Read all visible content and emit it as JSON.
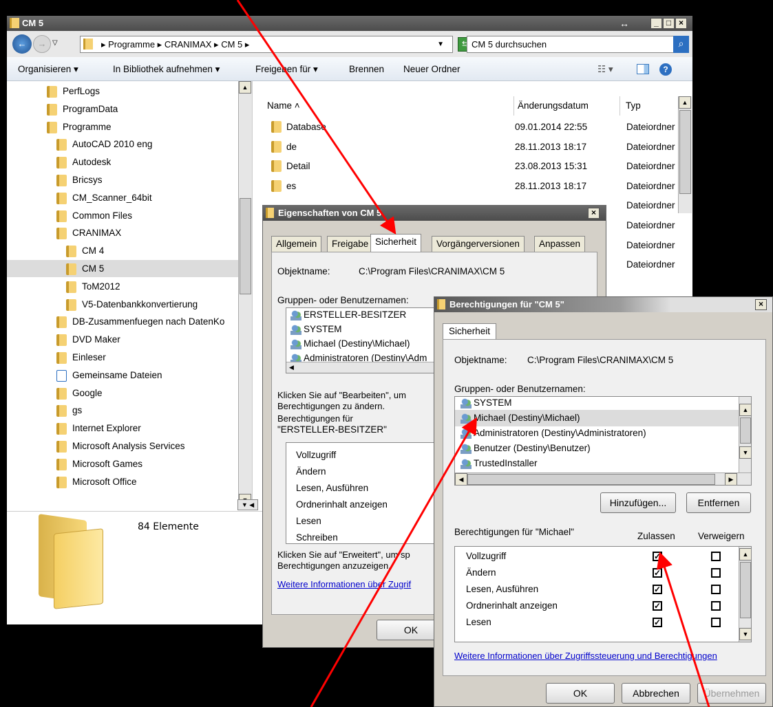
{
  "explorer": {
    "title": "CM 5",
    "address": [
      "Programme",
      "CRANIMAX",
      "CM 5"
    ],
    "search_placeholder": "CM 5 durchsuchen",
    "toolbar": {
      "organize": "Organisieren",
      "library": "In Bibliothek aufnehmen",
      "share": "Freigeben für",
      "burn": "Brennen",
      "new_folder": "Neuer Ordner"
    },
    "tree": [
      {
        "label": "PerfLogs",
        "indent": 0
      },
      {
        "label": "ProgramData",
        "indent": 0
      },
      {
        "label": "Programme",
        "indent": 0
      },
      {
        "label": "AutoCAD 2010 eng",
        "indent": 1
      },
      {
        "label": "Autodesk",
        "indent": 1
      },
      {
        "label": "Bricsys",
        "indent": 1
      },
      {
        "label": "CM_Scanner_64bit",
        "indent": 1
      },
      {
        "label": "Common Files",
        "indent": 1
      },
      {
        "label": "CRANIMAX",
        "indent": 1
      },
      {
        "label": "CM 4",
        "indent": 2
      },
      {
        "label": "CM 5",
        "indent": 2,
        "selected": true
      },
      {
        "label": "ToM2012",
        "indent": 2
      },
      {
        "label": "V5-Datenbankkonvertierung",
        "indent": 2
      },
      {
        "label": "DB-Zusammenfuegen nach DatenKo",
        "indent": 1
      },
      {
        "label": "DVD Maker",
        "indent": 1
      },
      {
        "label": "Einleser",
        "indent": 1
      },
      {
        "label": "Gemeinsame Dateien",
        "indent": 1,
        "shortcut": true
      },
      {
        "label": "Google",
        "indent": 1
      },
      {
        "label": "gs",
        "indent": 1
      },
      {
        "label": "Internet Explorer",
        "indent": 1
      },
      {
        "label": "Microsoft Analysis Services",
        "indent": 1
      },
      {
        "label": "Microsoft Games",
        "indent": 1
      },
      {
        "label": "Microsoft Office",
        "indent": 1
      }
    ],
    "columns": {
      "name": "Name",
      "date": "Änderungsdatum",
      "type": "Typ"
    },
    "files": [
      {
        "name": "Database",
        "date": "09.01.2014 22:55",
        "type": "Dateiordner"
      },
      {
        "name": "de",
        "date": "28.11.2013 18:17",
        "type": "Dateiordner"
      },
      {
        "name": "Detail",
        "date": "23.08.2013 15:31",
        "type": "Dateiordner"
      },
      {
        "name": "es",
        "date": "28.11.2013 18:17",
        "type": "Dateiordner"
      },
      {
        "name": "",
        "date": "",
        "type": "Dateiordner"
      },
      {
        "name": "",
        "date": "",
        "type": "Dateiordner"
      },
      {
        "name": "",
        "date": "",
        "type": "Dateiordner"
      },
      {
        "name": "",
        "date": "",
        "type": "Dateiordner"
      }
    ],
    "status": "84 Elemente"
  },
  "props": {
    "title": "Eigenschaften von CM 5",
    "tabs": [
      "Allgemein",
      "Freigabe",
      "Sicherheit",
      "Vorgängerversionen",
      "Anpassen"
    ],
    "object_label": "Objektname:",
    "object_value": "C:\\Program Files\\CRANIMAX\\CM 5",
    "groups_label": "Gruppen- oder Benutzernamen:",
    "users": [
      "ERSTELLER-BESITZER",
      "SYSTEM",
      "Michael (Destiny\\Michael)",
      "Administratoren (Destiny\\Adm"
    ],
    "edit_hint": "Klicken Sie auf \"Bearbeiten\", um",
    "edit_hint2": "Berechtigungen zu ändern.",
    "perm_for": "Berechtigungen für",
    "perm_for_user": "\"ERSTELLER-BESITZER\"",
    "perms": [
      "Vollzugriff",
      "Ändern",
      "Lesen, Ausführen",
      "Ordnerinhalt anzeigen",
      "Lesen",
      "Schreiben"
    ],
    "adv_hint": "Klicken Sie auf \"Erweitert\", um sp",
    "adv_hint2": "Berechtigungen anzuzeigen.",
    "link": "Weitere Informationen über Zugrif",
    "ok": "OK"
  },
  "perm": {
    "title": "Berechtigungen für \"CM 5\"",
    "tab": "Sicherheit",
    "object_label": "Objektname:",
    "object_value": "C:\\Program Files\\CRANIMAX\\CM 5",
    "groups_label": "Gruppen- oder Benutzernamen:",
    "users": [
      "SYSTEM",
      "Michael (Destiny\\Michael)",
      "Administratoren (Destiny\\Administratoren)",
      "Benutzer (Destiny\\Benutzer)",
      "TrustedInstaller"
    ],
    "add": "Hinzufügen...",
    "remove": "Entfernen",
    "perm_for": "Berechtigungen für \"Michael\"",
    "allow": "Zulassen",
    "deny": "Verweigern",
    "perms": [
      {
        "label": "Vollzugriff",
        "allow": true,
        "deny": false
      },
      {
        "label": "Ändern",
        "allow": true,
        "deny": false
      },
      {
        "label": "Lesen, Ausführen",
        "allow": true,
        "deny": false
      },
      {
        "label": "Ordnerinhalt anzeigen",
        "allow": true,
        "deny": false
      },
      {
        "label": "Lesen",
        "allow": true,
        "deny": false
      }
    ],
    "link": "Weitere Informationen über Zugriffssteuerung und Berechtigungen",
    "ok": "OK",
    "cancel": "Abbrechen",
    "apply": "Übernehmen"
  },
  "colors": {
    "annotation": "#ff0000",
    "selection": "#dcdcdc",
    "link": "#0000cc"
  }
}
